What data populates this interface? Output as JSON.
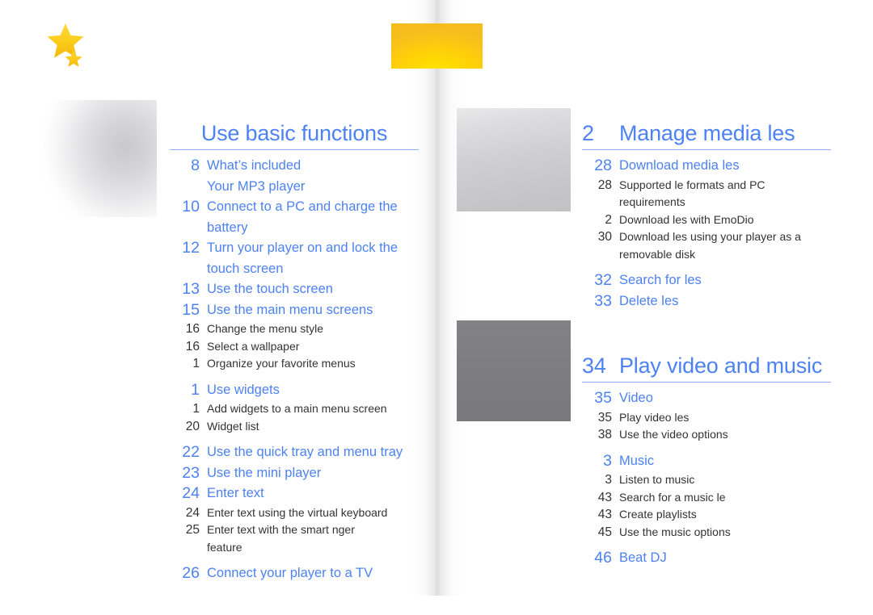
{
  "document": {
    "type": "table-of-contents",
    "colors": {
      "accent_blue": "#4d82f3",
      "rule_blue": "#8eaff7",
      "body_dark": "#333335",
      "highlight_yellow": "#ffdc02",
      "gray_dark": "#7d7d7f",
      "gray_light": "#cfcfd1"
    }
  },
  "decorations": {
    "star_large": "star-icon",
    "star_small": "star-icon",
    "yellow_block": "yellow-gradient-block",
    "gray_blob": "gray-gradient-blob",
    "gray_box_light": "light-gray-image-placeholder",
    "gray_box_dark": "dark-gray-image-placeholder",
    "gutter": "page-gutter-shadow"
  },
  "left_column": {
    "sections": [
      {
        "number": "",
        "title": "Use basic functions",
        "centered": true,
        "entries": [
          {
            "page": "8",
            "label": "What’s included",
            "level": 1
          },
          {
            "page": "",
            "label": "Your MP3 player",
            "level": 1
          },
          {
            "page": "10",
            "label": "Connect to a PC and charge the",
            "level": 1
          },
          {
            "page": "",
            "label": "battery",
            "level": 1
          },
          {
            "page": "12",
            "label": "Turn your player on and lock the",
            "level": 1
          },
          {
            "page": "",
            "label": "touch screen",
            "level": 1
          },
          {
            "page": "13",
            "label": "Use the touch screen",
            "level": 1
          },
          {
            "page": "15",
            "label": "Use the main menu screens",
            "level": 1
          },
          {
            "page": "16",
            "label": "Change the menu style",
            "level": 2
          },
          {
            "page": "16",
            "label": "Select a wallpaper",
            "level": 2
          },
          {
            "page": "1",
            "label": "Organize your favorite menus",
            "level": 2
          },
          {
            "page": "1",
            "label": "Use widgets",
            "level": 1,
            "gap_before": true
          },
          {
            "page": "1",
            "label": "Add widgets to a main menu screen",
            "level": 2
          },
          {
            "page": "20",
            "label": "Widget list",
            "level": 2
          },
          {
            "page": "22",
            "label": "Use the quick tray and menu tray",
            "level": 1,
            "gap_before": true
          },
          {
            "page": "23",
            "label": "Use the mini player",
            "level": 1
          },
          {
            "page": "24",
            "label": "Enter text",
            "level": 1
          },
          {
            "page": "24",
            "label": "Enter text using the virtual keyboard",
            "level": 2
          },
          {
            "page": "25",
            "label": "Enter text with the smart  nger",
            "level": 2
          },
          {
            "page": "",
            "label": "feature",
            "level": 2
          },
          {
            "page": "26",
            "label": "Connect your player to a TV",
            "level": 1,
            "gap_before": true
          }
        ]
      }
    ]
  },
  "right_column": {
    "sections": [
      {
        "number": "2",
        "title": "Manage media  les",
        "centered": false,
        "entries": [
          {
            "page": "28",
            "label": "Download media  les",
            "level": 1
          },
          {
            "page": "28",
            "label": "Supported  le formats and PC",
            "level": 2
          },
          {
            "page": "",
            "label": "requirements",
            "level": 2
          },
          {
            "page": "2",
            "label": "Download  les with EmoDio",
            "level": 2
          },
          {
            "page": "30",
            "label": "Download  les using your player as a",
            "level": 2
          },
          {
            "page": "",
            "label": "removable disk",
            "level": 2
          },
          {
            "page": "32",
            "label": "Search for  les",
            "level": 1,
            "gap_before": true
          },
          {
            "page": "33",
            "label": "Delete  les",
            "level": 1
          }
        ]
      },
      {
        "number": "34",
        "title": "Play video and music",
        "centered": false,
        "entries": [
          {
            "page": "35",
            "label": "Video",
            "level": 1
          },
          {
            "page": "35",
            "label": "Play video  les",
            "level": 2
          },
          {
            "page": "38",
            "label": "Use the video options",
            "level": 2
          },
          {
            "page": "3",
            "label": "Music",
            "level": 1,
            "gap_before": true
          },
          {
            "page": "3",
            "label": "Listen to music",
            "level": 2
          },
          {
            "page": "43",
            "label": "Search for a music  le",
            "level": 2
          },
          {
            "page": "43",
            "label": "Create playlists",
            "level": 2
          },
          {
            "page": "45",
            "label": "Use the music options",
            "level": 2
          },
          {
            "page": "46",
            "label": "Beat DJ",
            "level": 1,
            "gap_before": true
          }
        ]
      }
    ]
  }
}
